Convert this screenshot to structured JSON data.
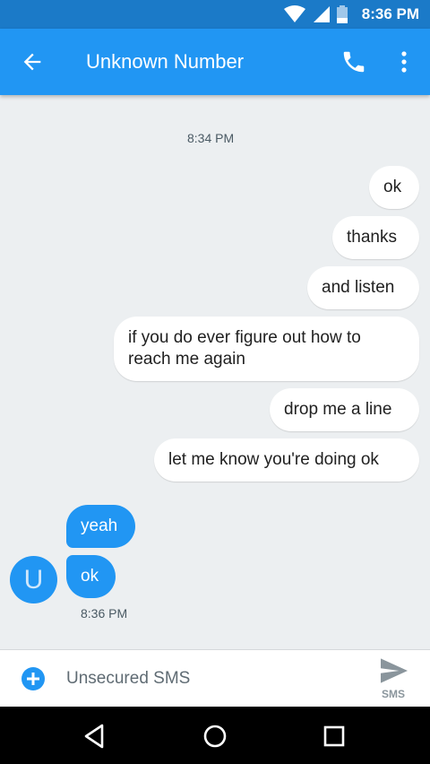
{
  "status_bar": {
    "time": "8:36 PM"
  },
  "header": {
    "title": "Unknown Number",
    "back_icon": "arrow-left-icon",
    "call_icon": "phone-icon",
    "menu_icon": "more-vert-icon"
  },
  "conversation": {
    "top_timestamp": "8:34 PM",
    "outgoing": [
      "ok",
      "thanks",
      "and listen",
      "if you do ever figure out how to reach me again",
      "drop me a line",
      "let me know you're doing ok"
    ],
    "incoming": [
      "yeah",
      "ok"
    ],
    "incoming_timestamp": "8:36 PM",
    "avatar_letter": "U"
  },
  "compose": {
    "placeholder": "Unsecured SMS",
    "send_label": "SMS"
  },
  "colors": {
    "status_bar": "#1b7ac8",
    "app_bar": "#2196f3",
    "incoming_bubble": "#2196f3",
    "background": "#eceff1"
  }
}
